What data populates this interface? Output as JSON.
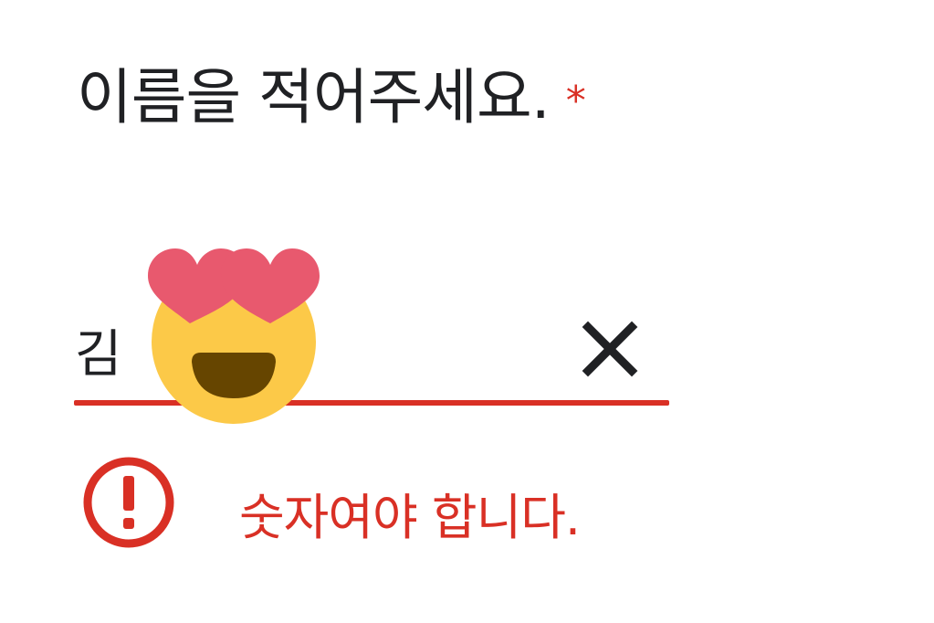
{
  "question": {
    "label": "이름을 적어주세요.",
    "required_mark": "*"
  },
  "answer": {
    "value": "김"
  },
  "clear_button": {
    "icon": "close-icon"
  },
  "error": {
    "icon": "error-icon",
    "message": "숫자여야 합니다."
  },
  "sticker": {
    "icon": "heart-eyes-emoji"
  },
  "colors": {
    "error": "#d93025",
    "text": "#202124",
    "emoji_face": "#fcc948",
    "emoji_heart": "#e8596e",
    "emoji_mouth": "#664500"
  }
}
